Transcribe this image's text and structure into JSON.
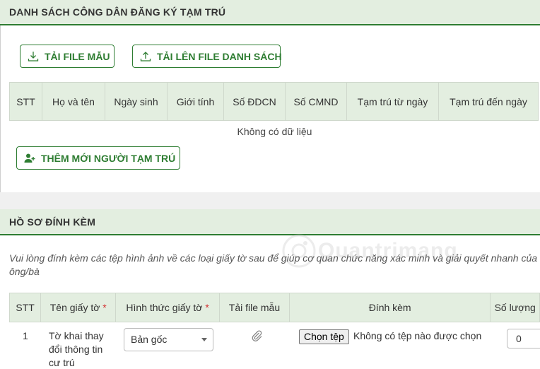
{
  "section1": {
    "title": "DANH SÁCH CÔNG DÂN ĐĂNG KÝ TẠM TRÚ",
    "btn_download_template": "TẢI FILE MẪU",
    "btn_upload_list": "TẢI LÊN FILE DANH SÁCH",
    "columns": [
      "STT",
      "Họ và tên",
      "Ngày sinh",
      "Giới tính",
      "Số ĐDCN",
      "Số CMND",
      "Tạm trú từ ngày",
      "Tạm trú đến ngày"
    ],
    "empty_message": "Không có dữ liệu",
    "btn_add_resident": "THÊM MỚI NGƯỜI TẠM TRÚ"
  },
  "section2": {
    "title": "HỒ SƠ ĐÍNH KÈM",
    "note": "Vui lòng đính kèm các tệp hình ảnh về các loại giấy tờ sau để giúp cơ quan chức năng xác minh và giải quyết nhanh của ông/bà",
    "columns": {
      "stt": "STT",
      "doc_name": "Tên giấy tờ",
      "doc_form": "Hình thức giấy tờ",
      "download_template": "Tải file mẫu",
      "attachment": "Đính kèm",
      "quantity": "Số lượng"
    },
    "required_mark": "*",
    "rows": [
      {
        "stt": "1",
        "doc_name": "Tờ khai thay đổi thông tin cư trú",
        "doc_form": "Bản gốc",
        "file_button": "Chọn tệp",
        "file_status": "Không có tệp nào được chọn",
        "quantity": "0"
      }
    ]
  },
  "watermark": "Quantrimang",
  "colors": {
    "accent": "#2e7d32",
    "header_bg": "#e3eee0",
    "required": "#d32f2f"
  }
}
